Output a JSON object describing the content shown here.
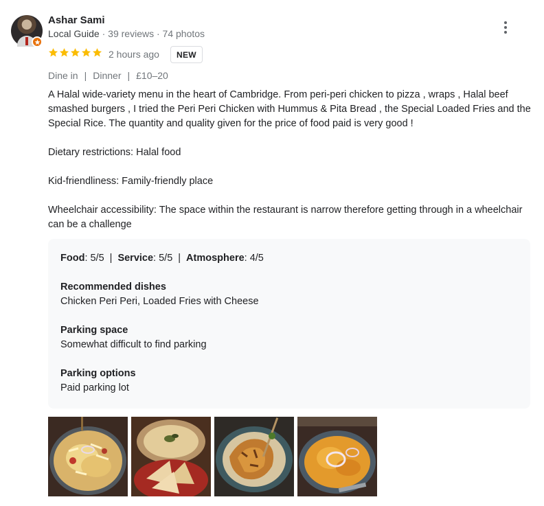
{
  "reviewer": {
    "name": "Ashar Sami",
    "guide_label": "Local Guide",
    "reviews": "39 reviews",
    "photos": "74 photos",
    "separator": " · "
  },
  "rating": {
    "stars": 5,
    "max_stars": 5,
    "star_color": "#fbbc04",
    "time": "2 hours ago",
    "badge": "NEW"
  },
  "tags": [
    "Dine in",
    "Dinner",
    "£10–20"
  ],
  "review_text": "A Halal wide-variety menu in the heart of Cambridge. From peri-peri chicken to pizza , wraps , Halal beef smashed burgers  , I tried the Peri Peri Chicken with Hummus & Pita Bread , the Special Loaded Fries and the Special Rice. The quantity and quality given for the price of food paid is very good !",
  "paragraphs": [
    "Dietary restrictions: Halal food",
    "Kid-friendliness: Family-friendly place",
    "Wheelchair accessibility: The space within the restaurant is narrow therefore getting through in a wheelchair can be a challenge"
  ],
  "attributes": {
    "ratings": [
      {
        "label": "Food",
        "value": ": 5/5"
      },
      {
        "label": "Service",
        "value": ": 5/5"
      },
      {
        "label": "Atmosphere",
        "value": ": 4/5"
      }
    ],
    "pipe": "|",
    "recommended_label": "Recommended dishes",
    "recommended_value": "Chicken Peri Peri, Loaded Fries with Cheese",
    "parking_space_label": "Parking space",
    "parking_space_value": "Somewhat difficult to find parking",
    "parking_options_label": "Parking options",
    "parking_options_value": "Paid parking lot"
  },
  "photos": [
    {
      "icon": "food-photo-loaded-fries"
    },
    {
      "icon": "food-photo-hummus-pita"
    },
    {
      "icon": "food-photo-peri-peri-chicken"
    },
    {
      "icon": "food-photo-special-rice"
    }
  ],
  "colors": {
    "badge_orange": "#e8710a",
    "secondary_text": "#70757a",
    "attributes_bg": "#f8f9fa"
  }
}
